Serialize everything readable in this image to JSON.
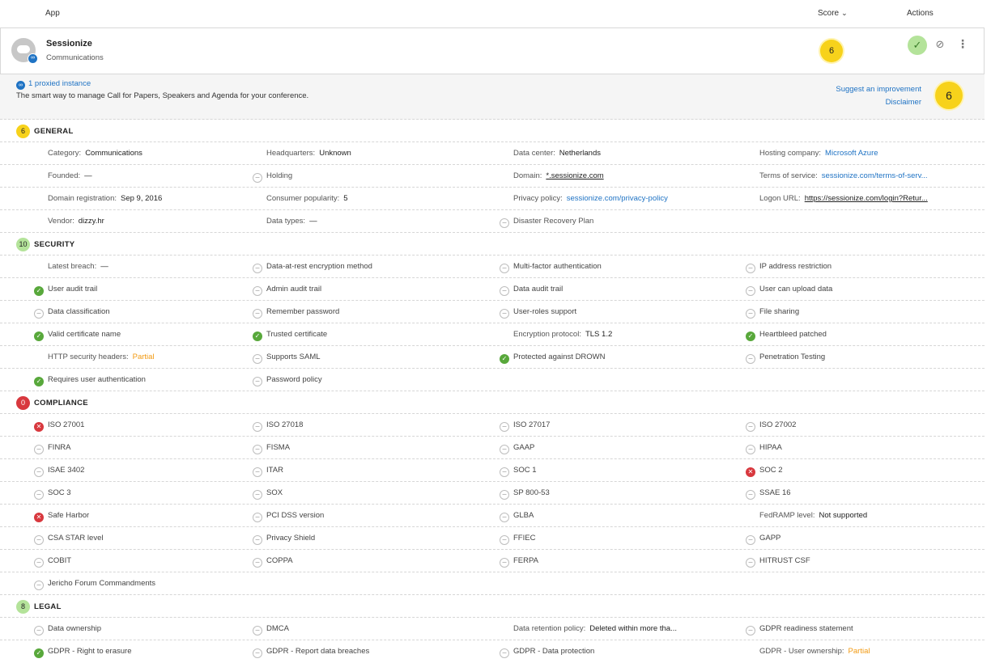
{
  "header": {
    "app": "App",
    "score": "Score",
    "actions": "Actions"
  },
  "app": {
    "name": "Sessionize",
    "category": "Communications",
    "score": "6",
    "proxied": "1 proxied instance",
    "description": "The smart way to manage Call for Papers, Speakers and Agenda for your conference.",
    "suggest": "Suggest an improvement",
    "disclaimer": "Disclaimer",
    "big_score": "6"
  },
  "colors": {
    "score_yellow": "#f7d21b",
    "score_green": "#b4e39a",
    "score_red": "#d8383e",
    "link": "#1f73c4",
    "partial": "#f29a12"
  },
  "sections": {
    "general": {
      "score": "6",
      "title": "GENERAL"
    },
    "security": {
      "score": "10",
      "title": "SECURITY"
    },
    "compliance": {
      "score": "0",
      "title": "COMPLIANCE"
    },
    "legal": {
      "score": "8",
      "title": "LEGAL"
    }
  },
  "general": {
    "category": {
      "label": "Category:",
      "value": "Communications"
    },
    "headquarters": {
      "label": "Headquarters:",
      "value": "Unknown"
    },
    "data_center": {
      "label": "Data center:",
      "value": "Netherlands"
    },
    "hosting": {
      "label": "Hosting company:",
      "value": "Microsoft Azure"
    },
    "founded": {
      "label": "Founded:",
      "value": "—"
    },
    "holding": {
      "label": "Holding"
    },
    "domain": {
      "label": "Domain:",
      "value": "*.sessionize.com"
    },
    "tos": {
      "label": "Terms of service:",
      "value": "sessionize.com/terms-of-serv..."
    },
    "domain_reg": {
      "label": "Domain registration:",
      "value": "Sep 9, 2016"
    },
    "popularity": {
      "label": "Consumer popularity:",
      "value": "5"
    },
    "privacy": {
      "label": "Privacy policy:",
      "value": "sessionize.com/privacy-policy"
    },
    "logon": {
      "label": "Logon URL:",
      "value": "https://sessionize.com/login?Retur..."
    },
    "vendor": {
      "label": "Vendor:",
      "value": "dizzy.hr"
    },
    "data_types": {
      "label": "Data types:",
      "value": "—"
    },
    "drp": {
      "label": "Disaster Recovery Plan"
    }
  },
  "security": {
    "latest_breach": {
      "label": "Latest breach:",
      "value": "—"
    },
    "dare": "Data-at-rest encryption method",
    "mfa": "Multi-factor authentication",
    "ip": "IP address restriction",
    "user_audit": "User audit trail",
    "admin_audit": "Admin audit trail",
    "data_audit": "Data audit trail",
    "upload": "User can upload data",
    "data_class": "Data classification",
    "remember": "Remember password",
    "roles": "User-roles support",
    "sharing": "File sharing",
    "cert_name": "Valid certificate name",
    "trusted_cert": "Trusted certificate",
    "encryption": {
      "label": "Encryption protocol:",
      "value": "TLS 1.2"
    },
    "heartbleed": "Heartbleed patched",
    "http_headers": {
      "label": "HTTP security headers:",
      "value": "Partial"
    },
    "saml": "Supports SAML",
    "drown": "Protected against DROWN",
    "pentest": "Penetration Testing",
    "user_auth": "Requires user authentication",
    "pw_policy": "Password policy"
  },
  "compliance": {
    "iso27001": "ISO 27001",
    "iso27018": "ISO 27018",
    "iso27017": "ISO 27017",
    "iso27002": "ISO 27002",
    "finra": "FINRA",
    "fisma": "FISMA",
    "gaap": "GAAP",
    "hipaa": "HIPAA",
    "isae": "ISAE 3402",
    "itar": "ITAR",
    "soc1": "SOC 1",
    "soc2": "SOC 2",
    "soc3": "SOC 3",
    "sox": "SOX",
    "sp80053": "SP 800-53",
    "ssae": "SSAE 16",
    "safe_harbor": "Safe Harbor",
    "pci": "PCI DSS version",
    "glba": "GLBA",
    "fedramp": {
      "label": "FedRAMP level:",
      "value": "Not supported"
    },
    "csa": "CSA STAR level",
    "privacy_shield": "Privacy Shield",
    "ffiec": "FFIEC",
    "gapp": "GAPP",
    "cobit": "COBIT",
    "coppa": "COPPA",
    "ferpa": "FERPA",
    "hitrust": "HITRUST CSF",
    "jericho": "Jericho Forum Commandments"
  },
  "legal": {
    "ownership": "Data ownership",
    "dmca": "DMCA",
    "retention": {
      "label": "Data retention policy:",
      "value": "Deleted within more tha..."
    },
    "gdpr_statement": "GDPR readiness statement",
    "erasure": "GDPR - Right to erasure",
    "breaches": "GDPR - Report data breaches",
    "protection": "GDPR - Data protection",
    "user_ownership": {
      "label": "GDPR - User ownership:",
      "value": "Partial"
    }
  }
}
